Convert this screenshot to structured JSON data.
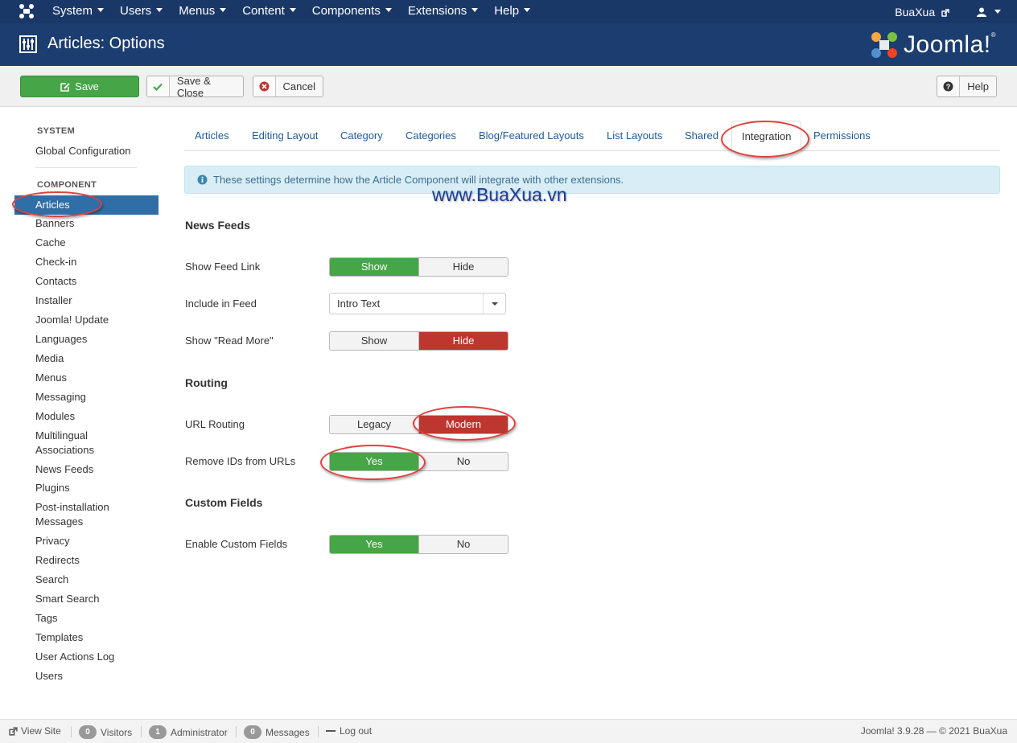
{
  "nav": {
    "logo_icon": "joomla-icon",
    "menu": [
      "System",
      "Users",
      "Menus",
      "Content",
      "Components",
      "Extensions",
      "Help"
    ],
    "user": "BuaXua",
    "user_icon": "user-icon"
  },
  "header": {
    "title": "Articles: Options",
    "brand": "Joomla!",
    "brand_reg": "®"
  },
  "toolbar": {
    "save": "Save",
    "save_close": "Save & Close",
    "cancel": "Cancel",
    "help": "Help"
  },
  "sidebar": {
    "system_heading": "SYSTEM",
    "global_config": "Global Configuration",
    "component_heading": "COMPONENT",
    "active": "Articles",
    "items": [
      "Banners",
      "Cache",
      "Check-in",
      "Contacts",
      "Installer",
      "Joomla! Update",
      "Languages",
      "Media",
      "Menus",
      "Messaging",
      "Modules",
      "Multilingual Associations",
      "News Feeds",
      "Plugins",
      "Post-installation Messages",
      "Privacy",
      "Redirects",
      "Search",
      "Smart Search",
      "Tags",
      "Templates",
      "User Actions Log",
      "Users"
    ]
  },
  "tabs": [
    "Articles",
    "Editing Layout",
    "Category",
    "Categories",
    "Blog/Featured Layouts",
    "List Layouts",
    "Shared",
    "Integration",
    "Permissions"
  ],
  "active_tab": "Integration",
  "info": "These settings determine how the Article Component will integrate with other extensions.",
  "watermark": "www.BuaXua.vn",
  "sections": {
    "news_feeds": "News Feeds",
    "routing": "Routing",
    "custom_fields": "Custom Fields"
  },
  "fields": {
    "show_feed_link": {
      "label": "Show Feed Link",
      "options": [
        "Show",
        "Hide"
      ],
      "selected": "Show"
    },
    "include_in_feed": {
      "label": "Include in Feed",
      "value": "Intro Text"
    },
    "show_read_more": {
      "label": "Show \"Read More\"",
      "options": [
        "Show",
        "Hide"
      ],
      "selected": "Hide"
    },
    "url_routing": {
      "label": "URL Routing",
      "options": [
        "Legacy",
        "Modern"
      ],
      "selected": "Modern"
    },
    "remove_ids": {
      "label": "Remove IDs from URLs",
      "options": [
        "Yes",
        "No"
      ],
      "selected": "Yes"
    },
    "enable_custom_fields": {
      "label": "Enable Custom Fields",
      "options": [
        "Yes",
        "No"
      ],
      "selected": "Yes"
    }
  },
  "colors": {
    "navbar": "#1a3867",
    "header": "#1c3d6f",
    "green": "#46a546",
    "red": "#bd362f",
    "active_blue": "#2f6ea6",
    "link": "#1f5a96",
    "annotation": "#e0413c"
  },
  "footer": {
    "view_site": "View Site",
    "visitors_count": "0",
    "visitors": "Visitors",
    "admin_count": "1",
    "admin": "Administrator",
    "messages_count": "0",
    "messages": "Messages",
    "logout": "Log out",
    "version": "Joomla! 3.9.28 — © 2021 BuaXua"
  }
}
